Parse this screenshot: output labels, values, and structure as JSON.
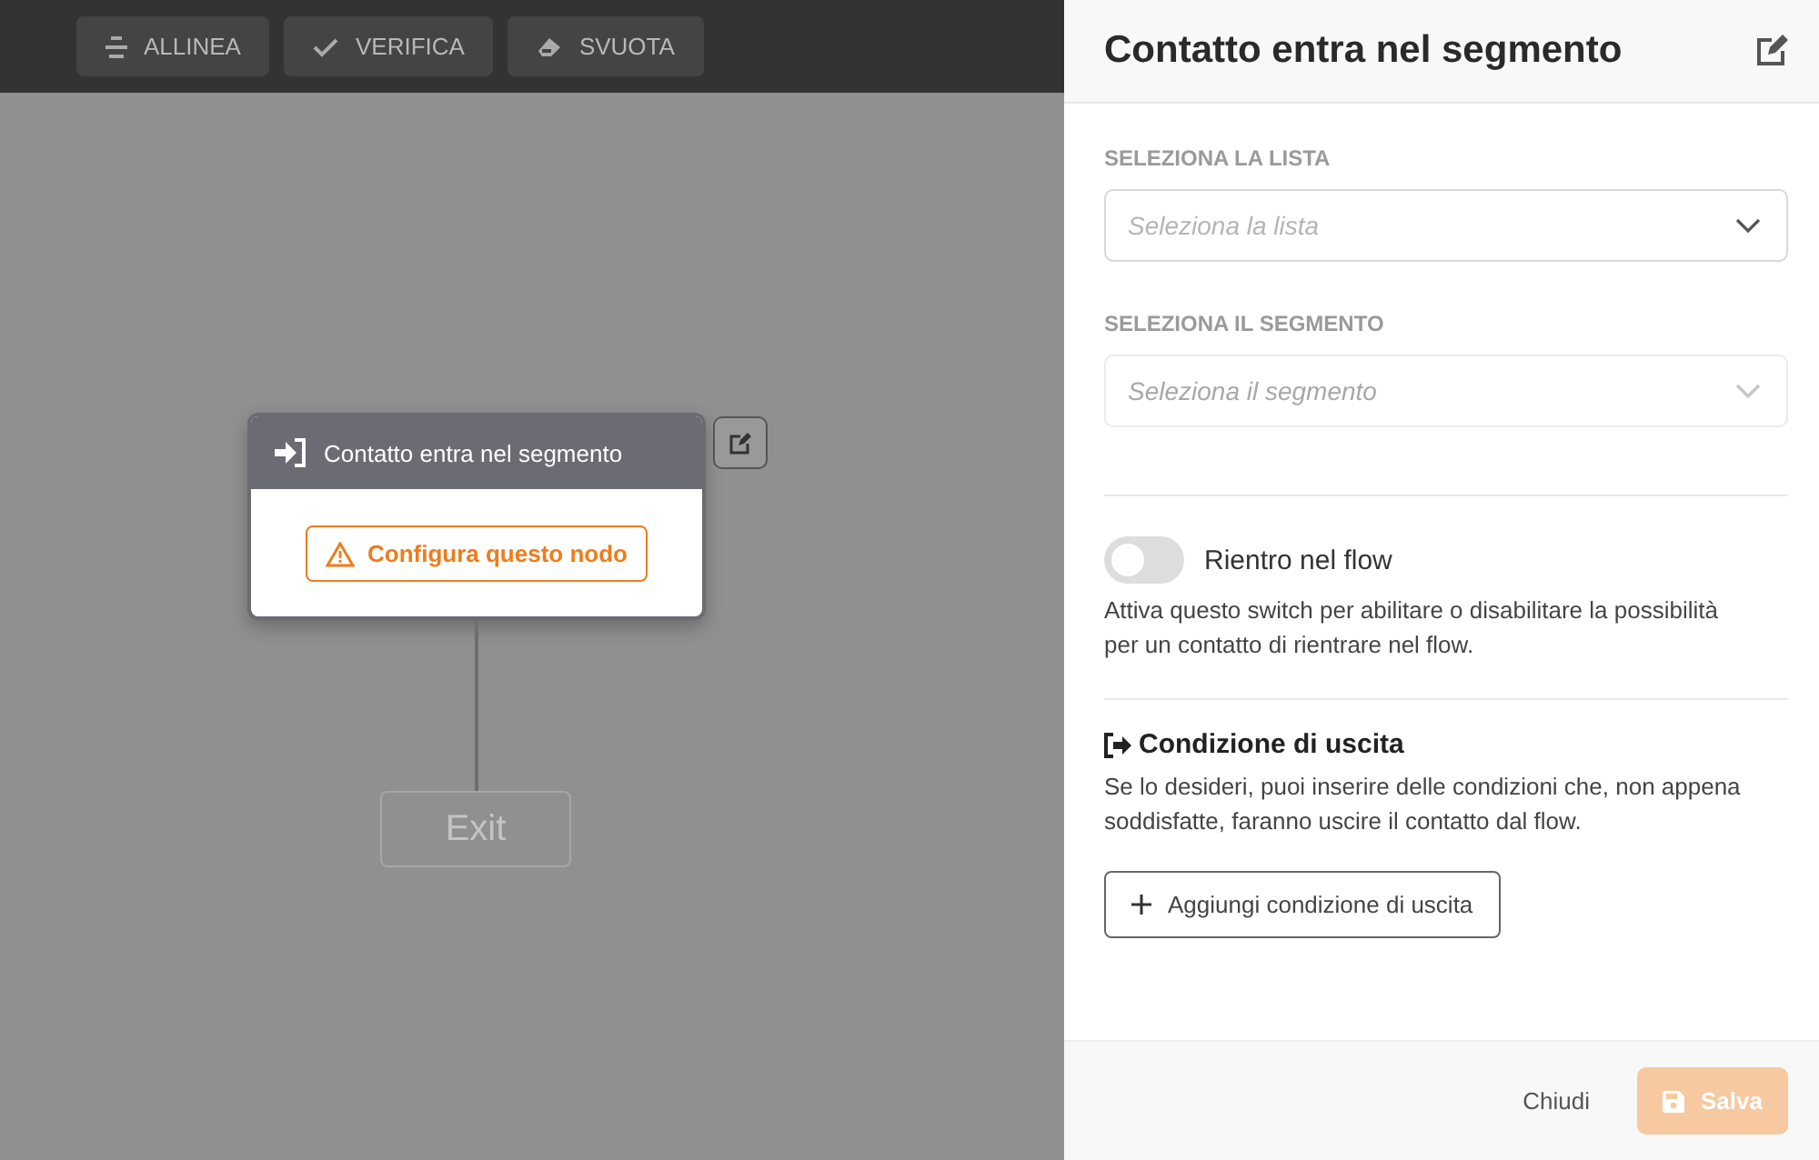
{
  "toolbar": [
    {
      "label": "ALLINEA",
      "kind": "align"
    },
    {
      "label": "VERIFICA",
      "kind": "check"
    },
    {
      "label": "SVUOTA",
      "kind": "erase"
    }
  ],
  "canvas": {
    "node": {
      "title": "Contatto entra nel segmento",
      "warning": "Configura questo nodo"
    },
    "exit": {
      "label": "Exit"
    }
  },
  "panel": {
    "title": "Contatto entra nel segmento",
    "fields": [
      {
        "label": "SELEZIONA LA LISTA",
        "placeholder": "Seleziona la lista",
        "disabled": false
      },
      {
        "label": "SELEZIONA IL SEGMENTO",
        "placeholder": "Seleziona il segmento",
        "disabled": true
      }
    ],
    "toggle": {
      "label": "Rientro nel flow",
      "on": false,
      "description": "Attiva questo switch per abilitare o disabilitare la possibilità per un contatto di rientrare nel flow."
    },
    "exit_condition": {
      "title": "Condizione di uscita",
      "description": "Se lo desideri, puoi inserire delle condizioni che, non appena soddisfatte, faranno uscire il contatto dal flow.",
      "button": "Aggiungi condizione di uscita"
    },
    "footer": {
      "close": "Chiudi",
      "save": {
        "label": "Salva",
        "disabled": true
      }
    }
  }
}
